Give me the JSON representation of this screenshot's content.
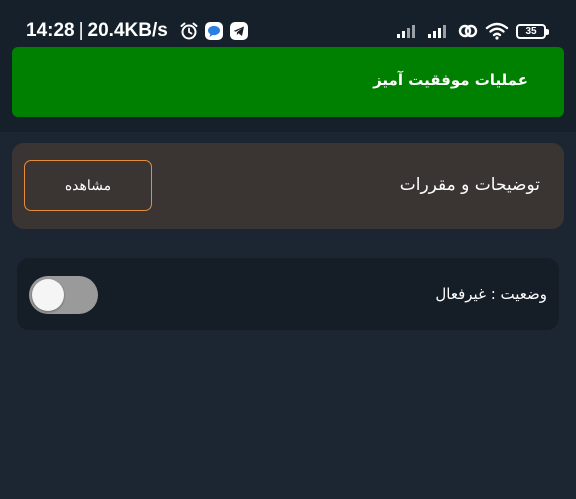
{
  "status_bar": {
    "time": "14:28",
    "separator": "|",
    "network_speed": "20.4KB/s",
    "battery_level": "35",
    "left_icons": [
      "alarm-icon",
      "chat-bubble-icon",
      "telegram-icon"
    ],
    "right_icons": [
      "signal-icon",
      "signal-icon",
      "hotspot-icon",
      "wifi-icon",
      "battery-icon"
    ]
  },
  "banner": {
    "message": "عملیات موفقیت آمیز",
    "color": "#008000"
  },
  "terms_card": {
    "label": "توضیحات و مقررات",
    "view_button": "مشاهده",
    "button_border_color": "#e58d3c"
  },
  "status_card": {
    "label": "وضعیت : غیرفعال",
    "toggle_on": false
  },
  "colors": {
    "background": "#1c2633",
    "top_area": "#16202b",
    "terms_card": "#3a3532",
    "status_card": "#151e27",
    "toggle_track": "#9a9a9a"
  }
}
